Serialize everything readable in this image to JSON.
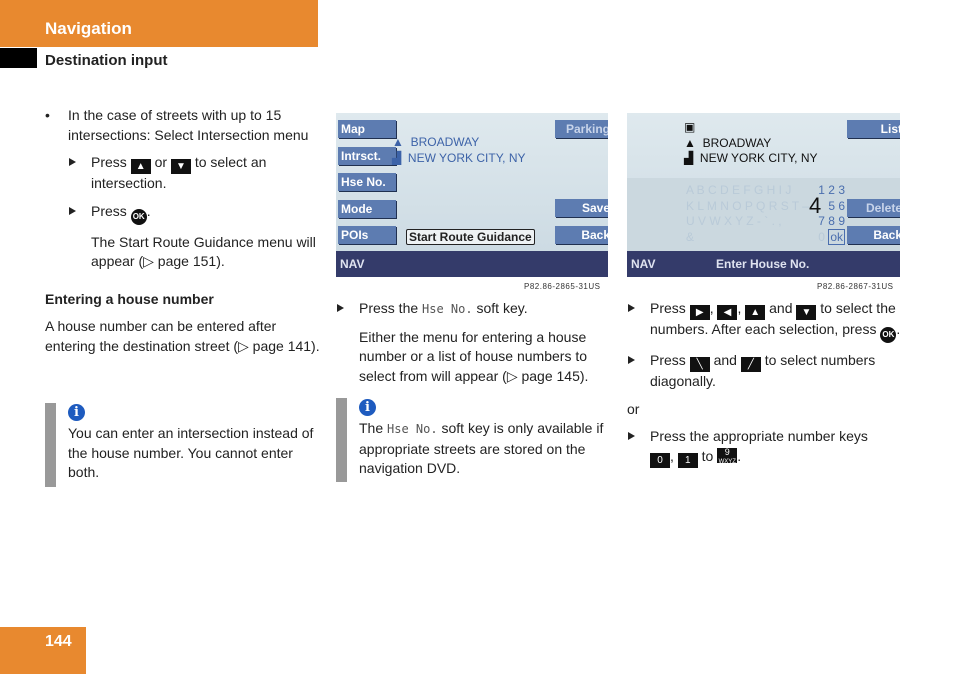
{
  "header": {
    "section": "Navigation",
    "subsection": "Destination input"
  },
  "page_number": "144",
  "left": {
    "bullet": "In the case of streets with up to 15 intersections: Select Intersection menu",
    "step1": {
      "pre": "Press",
      "mid": "or",
      "post": "to select an intersection."
    },
    "step2": {
      "pre": "Press",
      "post": "."
    },
    "result": "The Start Route Guidance menu will appear (▷ page 151).",
    "heading": "Entering a house number",
    "para": "A house number can be entered after entering the destination street (▷ page 141).",
    "note": "You can enter an intersection instead of the house number. You cannot enter both."
  },
  "screen1": {
    "left_keys": [
      "Map",
      "Intrsct.",
      "Hse No.",
      "Mode",
      "POIs"
    ],
    "right_keys": [
      "Parking",
      "Save",
      "Back"
    ],
    "street": "BROADWAY",
    "city": "NEW YORK CITY, NY",
    "start_button": "Start Route Guidance",
    "status": "NAV",
    "caption": "P82.86-2865-31US"
  },
  "middle": {
    "step_pre": "Press the",
    "softkey": "Hse No.",
    "step_post": "soft key.",
    "result": "Either the menu for entering a house number or a list of house numbers to select from will appear (▷ page 145).",
    "note_pre": "The",
    "note_softkey": "Hse No.",
    "note_post": "soft key is only available if appropriate streets are stored on the navigation DVD."
  },
  "screen2": {
    "right_keys": [
      "List",
      "Delete",
      "Back"
    ],
    "street": "BROADWAY",
    "city": "NEW YORK CITY, NY",
    "letters": [
      "A B C D E F G H I J",
      "K L M N O P Q R S T –",
      "U V W X Y Z - ` . ,",
      "&"
    ],
    "digits": [
      "1 2 3",
      "5 6",
      "7 8 9",
      "0"
    ],
    "selected": "4",
    "ok": "ok",
    "status": "NAV",
    "title": "Enter House No.",
    "caption": "P82.86-2867-31US"
  },
  "right": {
    "step1": {
      "pre": "Press",
      "and": "and",
      "post": "to select the numbers. After each selection, press",
      "end": "."
    },
    "step2": {
      "pre": "Press",
      "and": "and",
      "post": "to select numbers diagonally."
    },
    "or": "or",
    "step3": {
      "text": "Press the appropriate number keys",
      "to": "to",
      "k0": "0",
      "k1": "1",
      "k9": "9",
      "k9sub": "WXYZ"
    }
  },
  "key_glyphs": {
    "up": "▲",
    "down": "▼",
    "right": "▶",
    "left": "◀",
    "ok": "OK",
    "diag1": "╲",
    "diag2": "╱"
  },
  "colors": {
    "accent": "#E8892F",
    "softkey": "#5d7cb1",
    "navbar": "#343b6a",
    "info": "#1e5bbf"
  }
}
